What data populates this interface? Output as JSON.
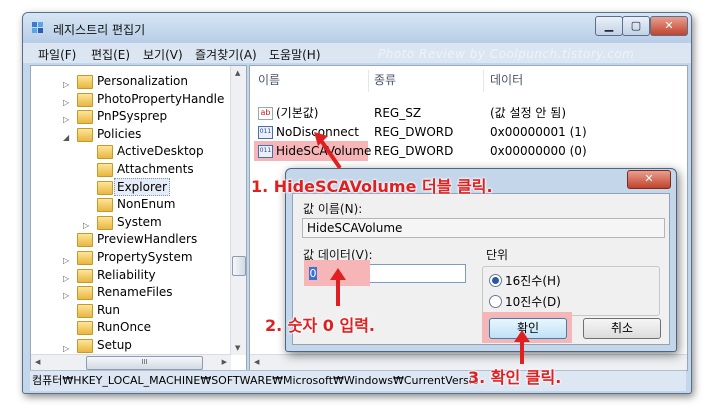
{
  "window": {
    "title": "레지스트리 편집기",
    "watermark": "Photo Review by Coolpunch.tistory.com",
    "buttons": {
      "minimize": "▁",
      "maximize": "▢",
      "close": "✕"
    }
  },
  "menu": [
    "파일(F)",
    "편집(E)",
    "보기(V)",
    "즐겨찾기(A)",
    "도움말(H)"
  ],
  "tree": [
    {
      "label": "Personalization",
      "expander": "▷",
      "level": 0
    },
    {
      "label": "PhotoPropertyHandle",
      "expander": "▷",
      "level": 0
    },
    {
      "label": "PnPSysprep",
      "expander": "▷",
      "level": 0
    },
    {
      "label": "Policies",
      "expander": "◢",
      "level": 0
    },
    {
      "label": "ActiveDesktop",
      "expander": "",
      "level": 1
    },
    {
      "label": "Attachments",
      "expander": "",
      "level": 1
    },
    {
      "label": "Explorer",
      "expander": "",
      "level": 1,
      "selected": true
    },
    {
      "label": "NonEnum",
      "expander": "",
      "level": 1
    },
    {
      "label": "System",
      "expander": "▷",
      "level": 1
    },
    {
      "label": "PreviewHandlers",
      "expander": "",
      "level": 0
    },
    {
      "label": "PropertySystem",
      "expander": "▷",
      "level": 0
    },
    {
      "label": "Reliability",
      "expander": "▷",
      "level": 0
    },
    {
      "label": "RenameFiles",
      "expander": "▷",
      "level": 0
    },
    {
      "label": "Run",
      "expander": "",
      "level": 0
    },
    {
      "label": "RunOnce",
      "expander": "",
      "level": 0
    },
    {
      "label": "Setup",
      "expander": "▷",
      "level": 0
    }
  ],
  "tree_scroll": {
    "thumb_glyph": "III"
  },
  "list": {
    "columns": {
      "name": "이름",
      "type": "종류",
      "data": "데이터"
    },
    "rows": [
      {
        "icon": "ab",
        "name": "(기본값)",
        "type": "REG_SZ",
        "data": "(값 설정 안 됨)"
      },
      {
        "icon": "bin",
        "name": "NoDisconnect",
        "type": "REG_DWORD",
        "data": "0x00000001 (1)"
      },
      {
        "icon": "bin",
        "name": "HideSCAVolume",
        "type": "REG_DWORD",
        "data": "0x00000000 (0)",
        "highlight": true
      }
    ]
  },
  "status": "컴퓨터₩HKEY_LOCAL_MACHINE₩SOFTWARE₩Microsoft₩Windows₩CurrentVersio",
  "dialog": {
    "close": "✕",
    "value_name_label": "값 이름(N):",
    "value_name": "HideSCAVolume",
    "value_data_label": "값 데이터(V):",
    "value_data": "0",
    "base_label": "단위",
    "hex_label": "16진수(H)",
    "dec_label": "10진수(D)",
    "ok": "확인",
    "cancel": "취소"
  },
  "annotations": {
    "step1": "1. HideSCAVolume 더블 클릭.",
    "step2": "2. 숫자 0 입력.",
    "step3": "3. 확인 클릭."
  },
  "colors": {
    "annotation": "#e02020",
    "highlight": "#f6b6b8",
    "window_frame": "#c3d6ea"
  }
}
